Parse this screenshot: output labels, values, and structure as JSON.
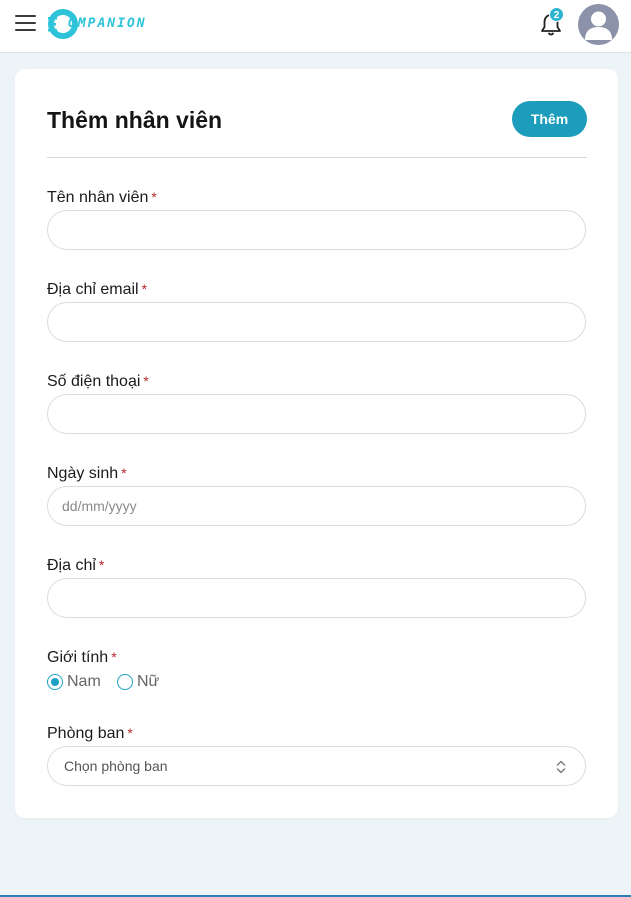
{
  "header": {
    "logo_text": "OMPANION",
    "notification_count": "2"
  },
  "form": {
    "title": "Thêm nhân viên",
    "add_button_label": "Thêm",
    "required_mark": "*",
    "fields": {
      "name": {
        "label": "Tên nhân viên",
        "value": "",
        "placeholder": ""
      },
      "email": {
        "label": "Địa chỉ email",
        "value": "",
        "placeholder": ""
      },
      "phone": {
        "label": "Số điện thoại",
        "value": "",
        "placeholder": ""
      },
      "dob": {
        "label": "Ngày sinh",
        "value": "",
        "placeholder": "dd/mm/yyyy"
      },
      "address": {
        "label": "Địa chỉ",
        "value": "",
        "placeholder": ""
      }
    },
    "gender": {
      "label": "Giới tính",
      "options": [
        "Nam",
        "Nữ"
      ],
      "selected": "Nam"
    },
    "department": {
      "label": "Phòng ban",
      "selected_text": "Chọn phòng ban"
    }
  },
  "colors": {
    "accent": "#1b9dbb",
    "logo": "#2ec3d9",
    "required": "#c0262d",
    "background": "#edf4f7"
  },
  "icons": [
    "menu-icon",
    "companion-logo",
    "bell-icon",
    "user-avatar-icon",
    "select-chevron-icon"
  ]
}
